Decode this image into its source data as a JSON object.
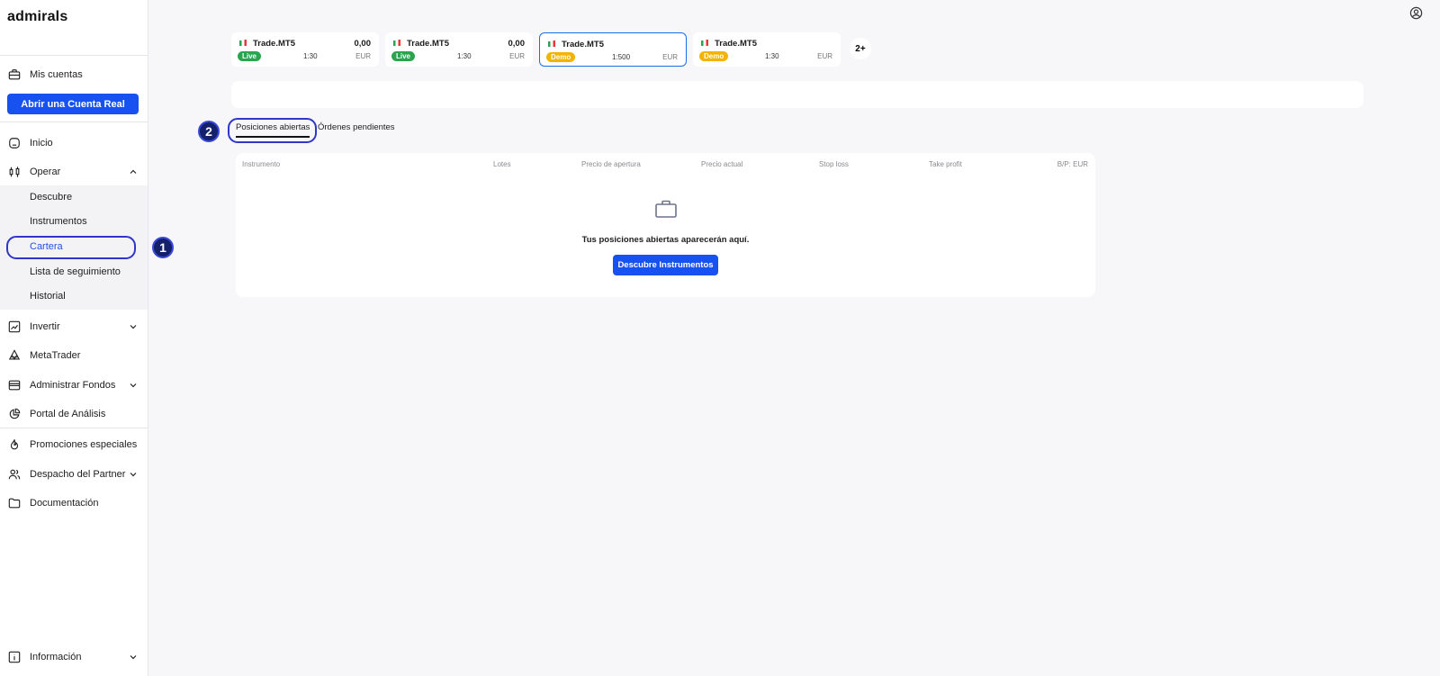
{
  "brand": {
    "logo": "admirals"
  },
  "sidebar": {
    "my_accounts": {
      "label": "Mis cuentas",
      "icon": "briefcase-icon"
    },
    "open_account_button": "Abrir una Cuenta Real",
    "items": [
      {
        "label": "Inicio",
        "icon": "home-icon"
      },
      {
        "label": "Operar",
        "icon": "candlestick-icon",
        "expanded": true
      },
      {
        "label": "Invertir",
        "icon": "chart-line-icon"
      },
      {
        "label": "MetaTrader",
        "icon": "metatrader-icon"
      },
      {
        "label": "Administrar Fondos",
        "icon": "wallet-icon"
      },
      {
        "label": "Portal de Análisis",
        "icon": "pie-chart-icon"
      },
      {
        "label": "Promociones especiales",
        "icon": "flame-icon"
      },
      {
        "label": "Despacho del Partner",
        "icon": "users-icon"
      },
      {
        "label": "Documentación",
        "icon": "folder-icon"
      },
      {
        "label": "Información",
        "icon": "info-icon"
      }
    ],
    "operar_sub": [
      {
        "label": "Descubre"
      },
      {
        "label": "Instrumentos"
      },
      {
        "label": "Cartera",
        "active": true
      },
      {
        "label": "Lista de seguimiento"
      },
      {
        "label": "Historial"
      }
    ]
  },
  "markers": {
    "one": "1",
    "two": "2"
  },
  "accounts": [
    {
      "name": "Trade.MT5",
      "value": "0,00",
      "badge": "Live",
      "leverage": "1:30",
      "currency": "EUR",
      "selected": false
    },
    {
      "name": "Trade.MT5",
      "value": "0,00",
      "badge": "Live",
      "leverage": "1:30",
      "currency": "EUR",
      "selected": false
    },
    {
      "name": "Trade.MT5",
      "value": "",
      "badge": "Demo",
      "leverage": "1:500",
      "currency": "EUR",
      "selected": true
    },
    {
      "name": "Trade.MT5",
      "value": "",
      "badge": "Demo",
      "leverage": "1:30",
      "currency": "EUR",
      "selected": false
    }
  ],
  "more_accounts": "2+",
  "tabs": [
    {
      "label": "Posiciones abiertas",
      "active": true
    },
    {
      "label": "Órdenes pendientes",
      "active": false
    }
  ],
  "table": {
    "columns": [
      "Instrumento",
      "Lotes",
      "Precio de apertura",
      "Precio actual",
      "Stop loss",
      "Take profit",
      "B/P: EUR"
    ],
    "empty_message": "Tus posiciones abiertas aparecerán aquí.",
    "empty_icon": "briefcase-icon",
    "cta_label": "Descubre Instrumentos"
  },
  "colors": {
    "accent": "#1751f0",
    "live": "#2aa44f",
    "demo": "#f2b400",
    "marker": "#13216b"
  }
}
